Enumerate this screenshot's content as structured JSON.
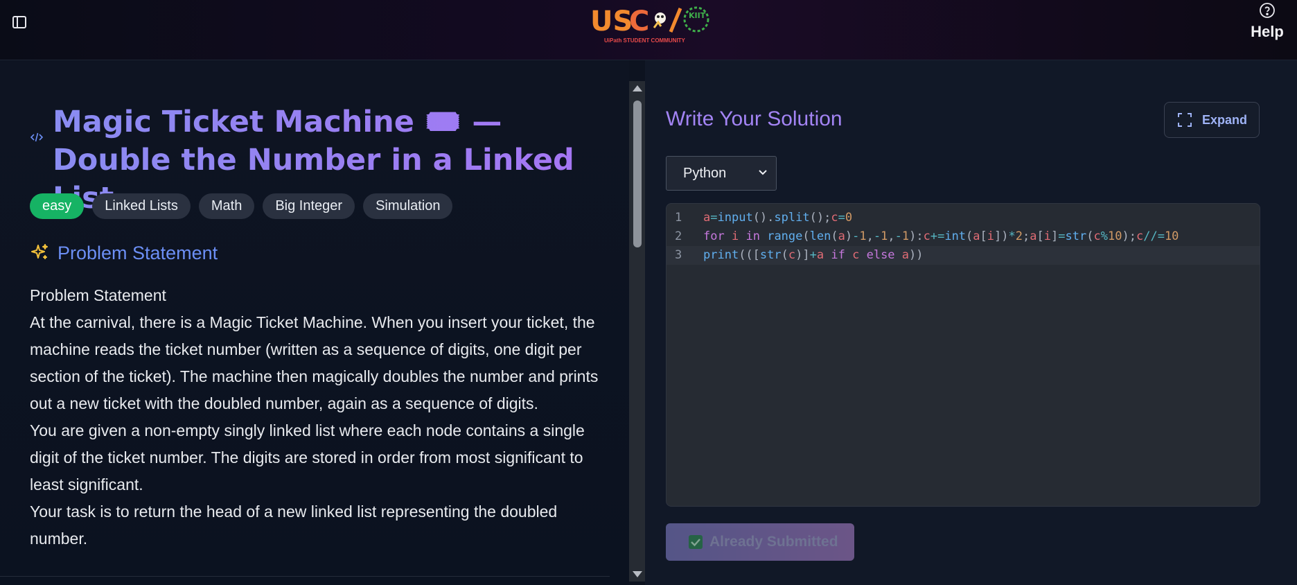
{
  "header": {
    "logo_text": "USC/KIIT",
    "logo_subtitle": "UiPath STUDENT COMMUNITY",
    "help_label": "Help"
  },
  "problem": {
    "title": "Magic Ticket Machine 🎟️ — Double the Number in a Linked List",
    "tags": [
      "easy",
      "Linked Lists",
      "Math",
      "Big Integer",
      "Simulation"
    ],
    "section_title": "Problem Statement",
    "paragraphs": [
      "Problem Statement",
      "At the carnival, there is a Magic Ticket Machine. When you insert your ticket, the machine reads the ticket number (written as a sequence of digits, one digit per section of the ticket). The machine then magically doubles the number and prints out a new ticket with the doubled number, again as a sequence of digits.",
      "You are given a non-empty singly linked list where each node contains a single digit of the ticket number. The digits are stored in order from most significant to least significant.",
      "Your task is to return the head of a new linked list representing the doubled number."
    ]
  },
  "solution": {
    "title": "Write Your Solution",
    "expand_label": "Expand",
    "language": "Python",
    "code_lines": [
      "a=input().split();c=0",
      "for i in range(len(a)-1,-1,-1):c+=int(a[i])*2;a[i]=str(c%10);c//=10",
      "print(([str(c)]+a if c else a))"
    ],
    "line_numbers": [
      "1",
      "2",
      "3"
    ],
    "submit_label": "Already Submitted"
  },
  "colors": {
    "accent_purple": "#a384f4",
    "accent_blue": "#6c8ff5",
    "easy_green": "#16b364"
  }
}
